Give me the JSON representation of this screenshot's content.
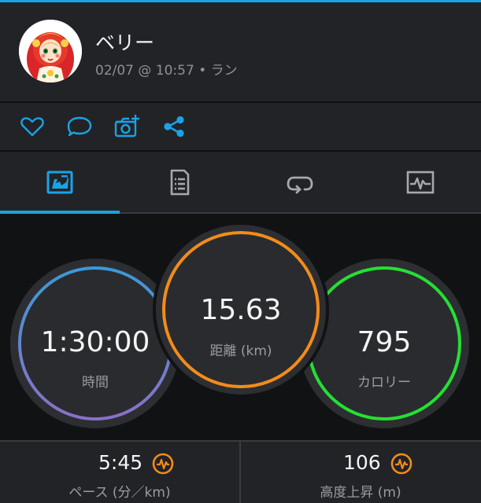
{
  "header": {
    "username": "ベリー",
    "meta": "02/07 @ 10:57 • ラン",
    "avatar_icon": "matryoshka-doll-avatar"
  },
  "actions": [
    {
      "name": "like",
      "icon": "heart-icon"
    },
    {
      "name": "comment",
      "icon": "speech-bubble-icon"
    },
    {
      "name": "add-photo",
      "icon": "camera-plus-icon"
    },
    {
      "name": "share",
      "icon": "share-icon"
    }
  ],
  "tabs": [
    {
      "name": "summary",
      "icon": "stats-card-icon",
      "active": true
    },
    {
      "name": "details",
      "icon": "document-icon",
      "active": false
    },
    {
      "name": "laps",
      "icon": "loop-arrow-icon",
      "active": false
    },
    {
      "name": "charts",
      "icon": "heartbeat-chart-icon",
      "active": false
    }
  ],
  "stats": {
    "time": {
      "value": "1:30:00",
      "label": "時間"
    },
    "distance": {
      "value": "15.63",
      "label": "距離 (km)"
    },
    "calories": {
      "value": "795",
      "label": "カロリー"
    }
  },
  "bottom": {
    "pace": {
      "value": "5:45",
      "label": "ペース (分／km)"
    },
    "elevation": {
      "value": "106",
      "label": "高度上昇 (m)"
    }
  },
  "colors": {
    "accent": "#19a3e6",
    "time_ring": "#5b7fd6",
    "distance_ring": "#f28c1a",
    "calories_ring": "#24e034",
    "badge": "#f28c1a"
  }
}
